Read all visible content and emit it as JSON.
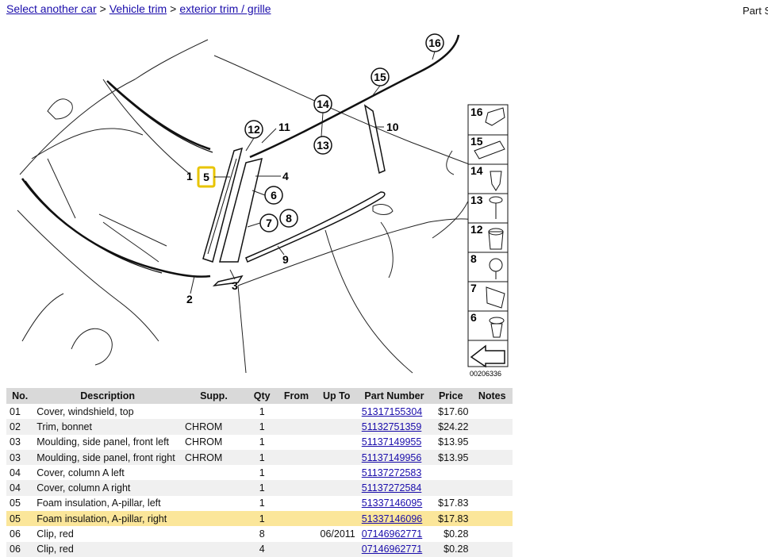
{
  "breadcrumb": {
    "items": [
      "Select another car",
      "Vehicle trim",
      "exterior trim / grille"
    ],
    "separator": ">"
  },
  "header": {
    "right_text": "Part S"
  },
  "diagram": {
    "image_code": "00206336",
    "callouts": [
      "1",
      "2",
      "3",
      "4",
      "5",
      "6",
      "7",
      "8",
      "9",
      "10",
      "11",
      "12",
      "13",
      "14",
      "15",
      "16"
    ],
    "highlighted_callout": "5",
    "legend": [
      "16",
      "15",
      "14",
      "13",
      "12",
      "8",
      "7",
      "6"
    ]
  },
  "table": {
    "columns": [
      "No.",
      "Description",
      "Supp.",
      "Qty",
      "From",
      "Up To",
      "Part Number",
      "Price",
      "Notes"
    ],
    "rows": [
      {
        "no": "01",
        "description": "Cover, windshield, top",
        "supp": "",
        "qty": "1",
        "from": "",
        "upto": "",
        "part": "51317155304",
        "price": "$17.60",
        "notes": ""
      },
      {
        "no": "02",
        "description": "Trim, bonnet",
        "supp": "CHROM",
        "qty": "1",
        "from": "",
        "upto": "",
        "part": "51132751359",
        "price": "$24.22",
        "notes": ""
      },
      {
        "no": "03",
        "description": "Moulding, side panel, front left",
        "supp": "CHROM",
        "qty": "1",
        "from": "",
        "upto": "",
        "part": "51137149955",
        "price": "$13.95",
        "notes": ""
      },
      {
        "no": "03",
        "description": "Moulding, side panel, front right",
        "supp": "CHROM",
        "qty": "1",
        "from": "",
        "upto": "",
        "part": "51137149956",
        "price": "$13.95",
        "notes": ""
      },
      {
        "no": "04",
        "description": "Cover, column A left",
        "supp": "",
        "qty": "1",
        "from": "",
        "upto": "",
        "part": "51137272583",
        "price": "",
        "notes": ""
      },
      {
        "no": "04",
        "description": "Cover, column A right",
        "supp": "",
        "qty": "1",
        "from": "",
        "upto": "",
        "part": "51137272584",
        "price": "",
        "notes": ""
      },
      {
        "no": "05",
        "description": "Foam insulation, A-pillar, left",
        "supp": "",
        "qty": "1",
        "from": "",
        "upto": "",
        "part": "51337146095",
        "price": "$17.83",
        "notes": ""
      },
      {
        "no": "05",
        "description": "Foam insulation, A-pillar, right",
        "supp": "",
        "qty": "1",
        "from": "",
        "upto": "",
        "part": "51337146096",
        "price": "$17.83",
        "notes": ""
      },
      {
        "no": "06",
        "description": "Clip, red",
        "supp": "",
        "qty": "8",
        "from": "",
        "upto": "06/2011",
        "part": "07146962771",
        "price": "$0.28",
        "notes": ""
      },
      {
        "no": "06",
        "description": "Clip, red",
        "supp": "",
        "qty": "4",
        "from": "",
        "upto": "",
        "part": "07146962771",
        "price": "$0.28",
        "notes": ""
      }
    ],
    "highlighted_row": 7
  }
}
